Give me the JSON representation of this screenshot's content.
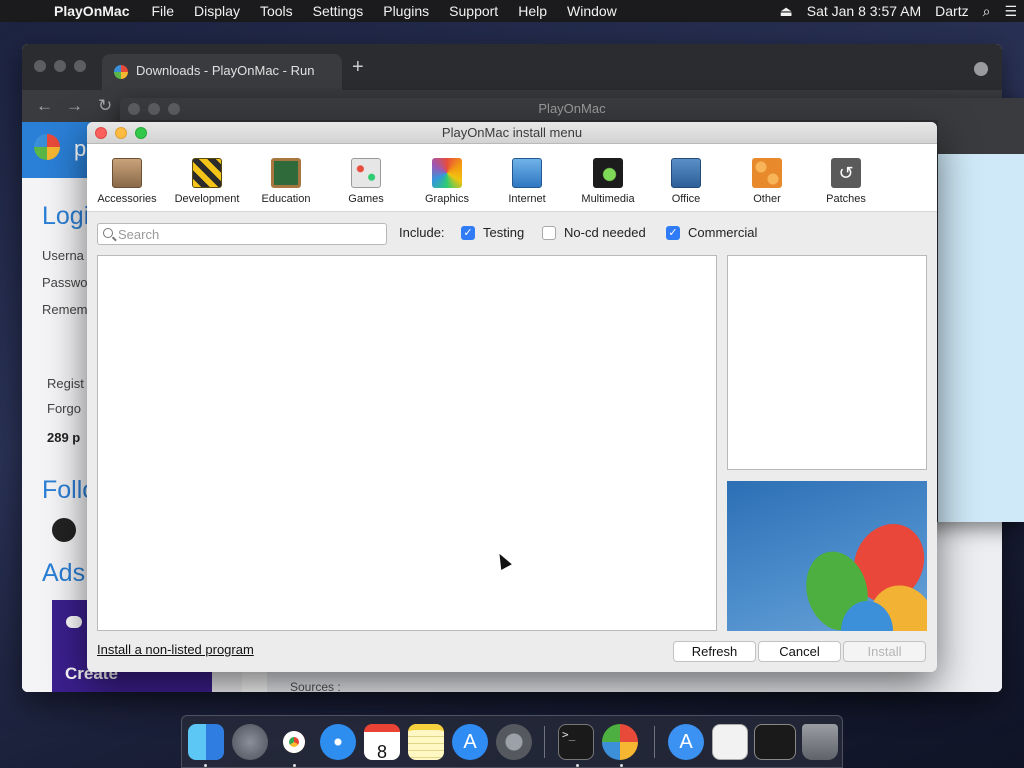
{
  "menubar": {
    "apple_icon": "apple-icon",
    "app_name": "PlayOnMac",
    "items": [
      "File",
      "Display",
      "Tools",
      "Settings",
      "Plugins",
      "Support",
      "Help",
      "Window"
    ],
    "clock": "Sat Jan 8  3:57 AM",
    "user": "Dartz"
  },
  "browser": {
    "tab_title": "Downloads - PlayOnMac - Run",
    "new_tab": "+",
    "site_logo_text": "p",
    "sidebar_texts": {
      "login": "Logi",
      "username": "Userna",
      "password": "Passwo",
      "remember": "Remem",
      "register": "Regist",
      "forgot": "Forgo",
      "count": "289 p",
      "follow": "Follo",
      "ads": "Ads"
    },
    "ad_text": "Create",
    "sources": "Sources :"
  },
  "pom_main": {
    "title": "PlayOnMac"
  },
  "dialog": {
    "title": "PlayOnMac install menu",
    "categories": [
      {
        "label": "Accessories",
        "icon": "calculator-icon"
      },
      {
        "label": "Development",
        "icon": "construction-icon"
      },
      {
        "label": "Education",
        "icon": "chalkboard-icon"
      },
      {
        "label": "Games",
        "icon": "gamepad-icon"
      },
      {
        "label": "Graphics",
        "icon": "color-palette-icon"
      },
      {
        "label": "Internet",
        "icon": "network-icon"
      },
      {
        "label": "Multimedia",
        "icon": "film-music-icon"
      },
      {
        "label": "Office",
        "icon": "chart-icon"
      },
      {
        "label": "Other",
        "icon": "other-icon"
      },
      {
        "label": "Patches",
        "icon": "refresh-icon"
      }
    ],
    "search_placeholder": "Search",
    "include_label": "Include:",
    "filters": [
      {
        "label": "Testing",
        "checked": true
      },
      {
        "label": "No-cd needed",
        "checked": false
      },
      {
        "label": "Commercial",
        "checked": true
      }
    ],
    "install_link": "Install a non-listed program",
    "buttons": {
      "refresh": "Refresh",
      "cancel": "Cancel",
      "install": "Install"
    }
  },
  "dock": {
    "apps": [
      "finder",
      "launchpad",
      "chrome",
      "safari",
      "calendar",
      "notes",
      "app-store",
      "system-preferences",
      "terminal",
      "playonmac",
      "app-store-download",
      "file",
      "window",
      "trash"
    ],
    "calendar_month": "JAN",
    "calendar_day": "8"
  },
  "colors": {
    "accent": "#2f7cf6",
    "site_blue": "#2a7fd6",
    "menubar": "#1b1b1d"
  }
}
